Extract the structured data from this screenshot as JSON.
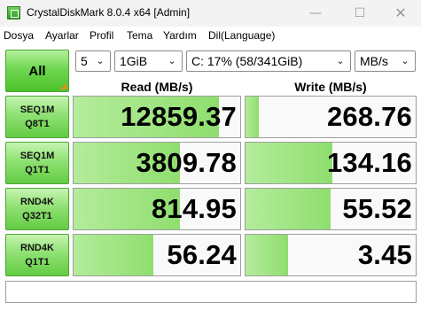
{
  "window": {
    "title": "CrystalDiskMark 8.0.4 x64 [Admin]",
    "controls": {
      "minimize": "—",
      "maximize": "☐",
      "close": "✕"
    }
  },
  "menu": [
    {
      "label": "Dosya"
    },
    {
      "label": "Ayarlar"
    },
    {
      "label": "Profil"
    },
    {
      "label": "Tema"
    },
    {
      "label": "Yardım"
    },
    {
      "label": "Dil(Language)"
    }
  ],
  "controls": {
    "all_label": "All",
    "count": "5",
    "size": "1GiB",
    "drive": "C: 17% (58/341GiB)",
    "unit": "MB/s",
    "chevron": "⌄"
  },
  "headers": {
    "read": "Read (MB/s)",
    "write": "Write (MB/s)"
  },
  "tests": [
    {
      "line1": "SEQ1M",
      "line2": "Q8T1",
      "read": "12859.37",
      "write": "268.76",
      "read_level": 0.87,
      "write_level": 0.08
    },
    {
      "line1": "SEQ1M",
      "line2": "Q1T1",
      "read": "3809.78",
      "write": "134.16",
      "read_level": 0.64,
      "write_level": 0.51
    },
    {
      "line1": "RND4K",
      "line2": "Q32T1",
      "read": "814.95",
      "write": "55.52",
      "read_level": 0.64,
      "write_level": 0.5
    },
    {
      "line1": "RND4K",
      "line2": "Q1T1",
      "read": "56.24",
      "write": "3.45",
      "read_level": 0.48,
      "write_level": 0.25
    }
  ],
  "status": "",
  "colors": {
    "accent_green": "#70d651",
    "bar_green": "#a3e688",
    "corner_orange": "#ee8a1c"
  }
}
